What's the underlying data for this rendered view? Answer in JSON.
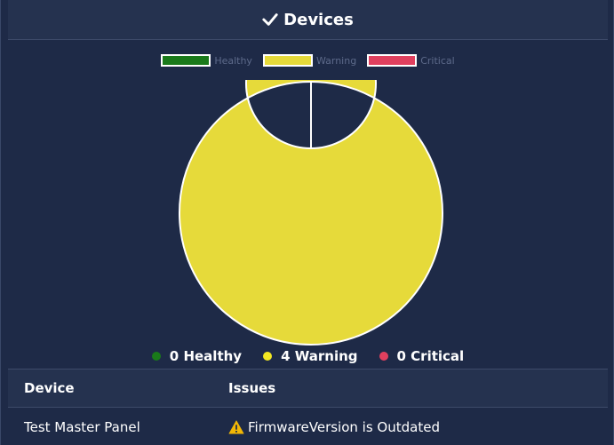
{
  "header": {
    "title": "Devices",
    "icon": "check-icon"
  },
  "legend": [
    {
      "label": "Healthy",
      "color": "#1a7a1a"
    },
    {
      "label": "Warning",
      "color": "#e6da3a"
    },
    {
      "label": "Critical",
      "color": "#e0405e"
    }
  ],
  "chart_data": {
    "type": "pie",
    "variant": "donut",
    "categories": [
      "Healthy",
      "Warning",
      "Critical"
    ],
    "values": [
      0,
      4,
      0
    ],
    "colors": [
      "#1a7a1a",
      "#e6da3a",
      "#e0405e"
    ],
    "legend_position": "top"
  },
  "summary": [
    {
      "text": "0 Healthy",
      "color": "#1a7a1a"
    },
    {
      "text": "4 Warning",
      "color": "#f3e823"
    },
    {
      "text": "0 Critical",
      "color": "#e0405e"
    }
  ],
  "table": {
    "columns": [
      "Device",
      "Issues"
    ],
    "rows": [
      {
        "device": "Test Master Panel",
        "issue": "FirmwareVersion is Outdated",
        "issue_icon": "warning-icon"
      }
    ]
  }
}
